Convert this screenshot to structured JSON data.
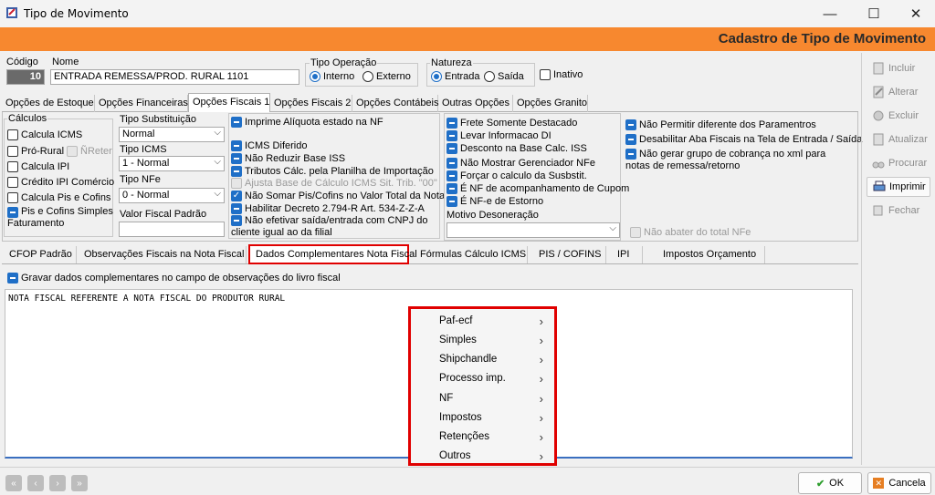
{
  "window": {
    "title": "Tipo de Movimento",
    "minimize": "—",
    "maximize": "☐",
    "close": "✕"
  },
  "header": {
    "title": "Cadastro de Tipo de Movimento"
  },
  "top": {
    "codigo_label": "Código",
    "codigo_value": "10",
    "nome_label": "Nome",
    "nome_value": "ENTRADA REMESSA/PROD. RURAL 1101",
    "tipo_operacao_label": "Tipo Operação",
    "interno": "Interno",
    "externo": "Externo",
    "natureza_label": "Natureza",
    "entrada": "Entrada",
    "saida": "Saída",
    "inativo": "Inativo"
  },
  "tabs1": [
    "Opções de Estoque",
    "Opções Financeiras",
    "Opções Fiscais 1",
    "Opções Fiscais 2",
    "Opções Contábeis",
    "Outras Opções",
    "Opções Granito"
  ],
  "calculos": {
    "title": "Cálculos",
    "items": [
      "Calcula ICMS",
      "Pró-Rural",
      "Calcula IPI",
      "Crédito IPI Comércio",
      "Calcula Pis e Cofins",
      "Pis e Cofins Simples Faturamento"
    ],
    "nreter": "ÑReter"
  },
  "col2": {
    "tipo_substituicao_label": "Tipo Substituição",
    "tipo_substituicao_value": "Normal",
    "tipo_icms_label": "Tipo ICMS",
    "tipo_icms_value": "1 - Normal",
    "tipo_nfe_label": "Tipo NFe",
    "tipo_nfe_value": "0 - Normal",
    "valor_fiscal_label": "Valor Fiscal Padrão"
  },
  "col3": [
    "Imprime Alíquota estado na NF",
    "ICMS Diferido",
    "Não Reduzir Base ISS",
    "Tributos Cálc. pela Planilha de Importação",
    "Ajusta Base de Cálculo ICMS Sit. Trib. \"00\"",
    "Não Somar Pis/Cofins no Valor Total da Nota",
    "Habilitar Decreto 2.794-R Art. 534-Z-Z-A",
    "Não efetivar saída/entrada com CNPJ do cliente igual ao da filial"
  ],
  "col4": [
    "Frete Somente Destacado",
    "Levar Informacao DI",
    "Desconto na Base Calc. ISS",
    "Não Mostrar Gerenciador NFe",
    "Forçar o calculo da Susbstit.",
    "É NF de acompanhamento de Cupom",
    "É NF-e de Estorno"
  ],
  "motivo_desoneracao_label": "Motivo Desoneração",
  "col5": [
    "Não Permitir diferente dos Paramentros",
    "Desabilitar Aba Fiscais na Tela de Entrada / Saída",
    "Não gerar grupo de cobrança no xml para notas de remessa/retorno"
  ],
  "nao_abater": "Não abater do total NFe",
  "tabs2": [
    "CFOP Padrão",
    "Observações Fiscais na Nota Fiscal",
    "Dados Complementares Nota Fiscal",
    "Fórmulas Cálculo ICMS",
    "PIS / COFINS",
    "IPI",
    "Impostos Orçamento"
  ],
  "gravar_label": "Gravar dados complementares no campo de observações do livro fiscal",
  "memo_text": "NOTA FISCAL REFERENTE A NOTA FISCAL DO PRODUTOR RURAL",
  "context_menu": [
    "Paf-ecf",
    "Simples",
    "Shipchandle",
    "Processo imp.",
    "NF",
    "Impostos",
    "Retenções",
    "Outros"
  ],
  "side_buttons": [
    "Incluir",
    "Alterar",
    "Excluir",
    "Atualizar",
    "Procurar",
    "Imprimir",
    "Fechar"
  ],
  "footer": {
    "ok": "OK",
    "cancela": "Cancela"
  },
  "colors": {
    "header": "#f7882f",
    "accent": "#1f6fc7",
    "highlight": "#e00000"
  }
}
